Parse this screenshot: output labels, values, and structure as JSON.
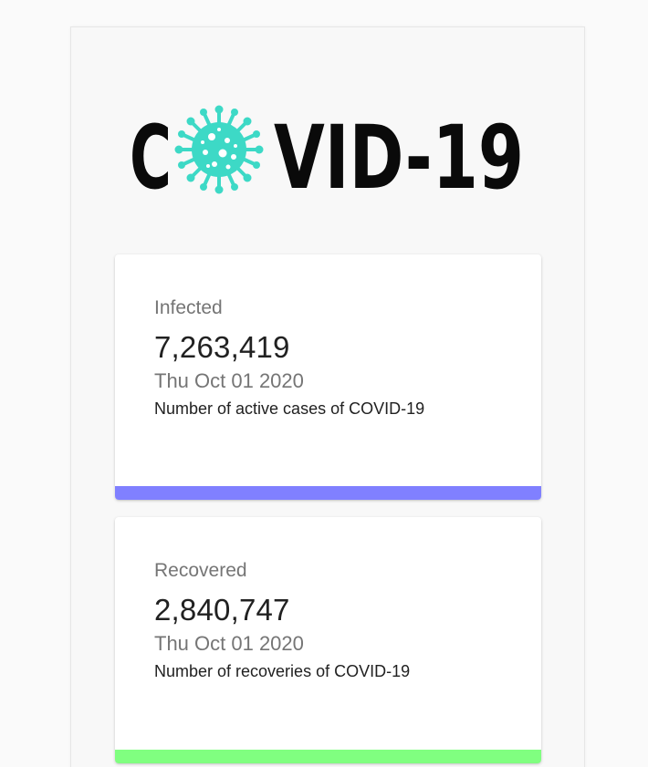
{
  "logo": {
    "text_left": "C",
    "text_right": "VID-19",
    "virus_color": "#3dd9c6",
    "text_color": "#0a0a0a"
  },
  "cards": [
    {
      "title": "Infected",
      "value": "7,263,419",
      "date": "Thu Oct 01 2020",
      "description": "Number of active cases of COVID-19",
      "bar_color": "#8080ff"
    },
    {
      "title": "Recovered",
      "value": "2,840,747",
      "date": "Thu Oct 01 2020",
      "description": "Number of recoveries of COVID-19",
      "bar_color": "#80ff80"
    }
  ]
}
